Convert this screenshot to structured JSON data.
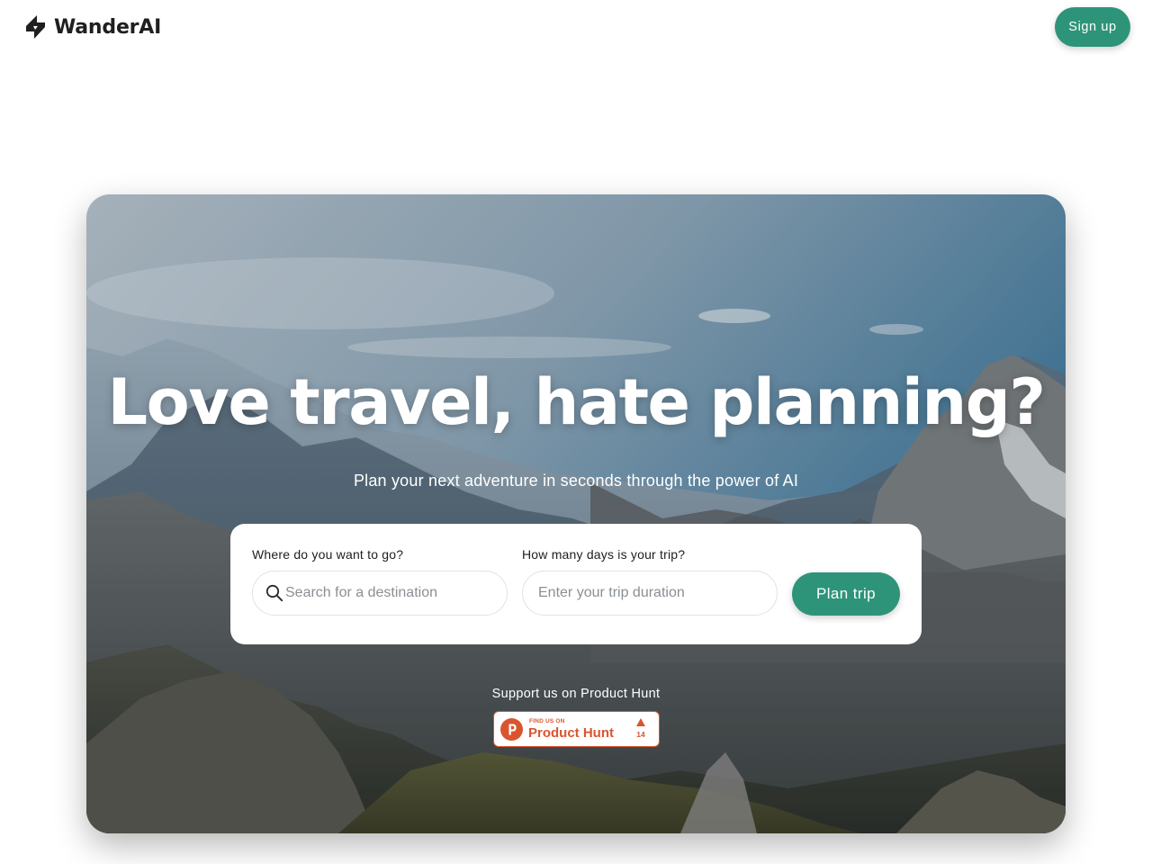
{
  "header": {
    "brand": "WanderAI",
    "logo_icon": "bolt-icon",
    "signup_label": "Sign up"
  },
  "hero": {
    "background_icon": "mountain-landscape-image",
    "headline": "Love travel, hate planning?",
    "subheadline": "Plan your next adventure in seconds through the power of AI"
  },
  "form": {
    "destination_label": "Where do you want to go?",
    "destination_placeholder": "Search for a destination",
    "destination_value": "",
    "duration_label": "How many days is your trip?",
    "duration_placeholder": "Enter your trip duration",
    "duration_value": "",
    "submit_label": "Plan trip"
  },
  "support": {
    "text": "Support us on Product Hunt",
    "badge_small": "FIND US ON",
    "badge_name": "Product Hunt",
    "badge_count": "14",
    "badge_icon": "product-hunt-icon"
  },
  "colors": {
    "accent": "#2e9479",
    "product_hunt": "#da552f"
  }
}
